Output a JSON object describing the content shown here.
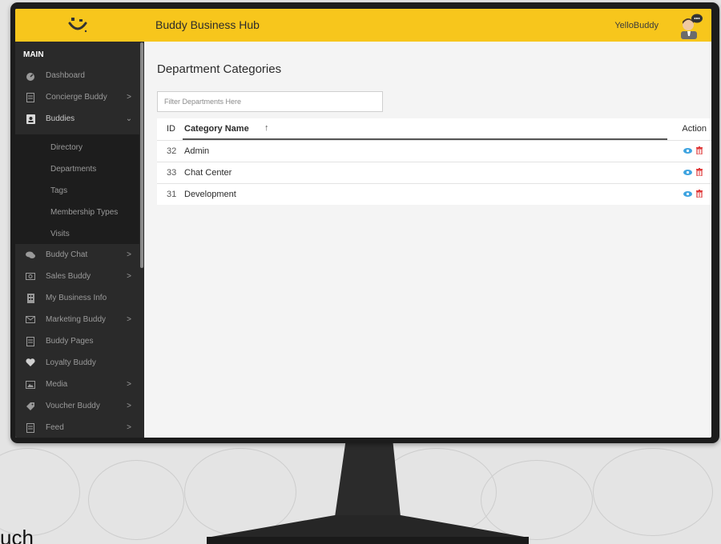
{
  "colors": {
    "accent": "#f7c61c",
    "sidebar_bg": "#2a2a2a",
    "view_icon": "#3da3e0",
    "delete_icon": "#e03a3a"
  },
  "header": {
    "app_title": "Buddy Business Hub",
    "user_name": "YelloBuddy"
  },
  "sidebar": {
    "section_label": "MAIN",
    "items": [
      {
        "label": "Dashboard",
        "icon": "dashboard-icon",
        "chevron": ""
      },
      {
        "label": "Concierge Buddy",
        "icon": "document-icon",
        "chevron": ">"
      },
      {
        "label": "Buddies",
        "icon": "contact-book-icon",
        "chevron": "⌄"
      },
      {
        "label": "Buddy Chat",
        "icon": "chat-icon",
        "chevron": ">"
      },
      {
        "label": "Sales Buddy",
        "icon": "money-icon",
        "chevron": ">"
      },
      {
        "label": "My Business Info",
        "icon": "building-icon",
        "chevron": ""
      },
      {
        "label": "Marketing Buddy",
        "icon": "envelope-icon",
        "chevron": ">"
      },
      {
        "label": "Buddy Pages",
        "icon": "document-icon",
        "chevron": ""
      },
      {
        "label": "Loyalty Buddy",
        "icon": "heart-icon",
        "chevron": ""
      },
      {
        "label": "Media",
        "icon": "image-icon",
        "chevron": ">"
      },
      {
        "label": "Voucher Buddy",
        "icon": "tag-icon",
        "chevron": ">"
      },
      {
        "label": "Feed",
        "icon": "document-icon",
        "chevron": ">"
      }
    ],
    "subitems": [
      {
        "label": "Directory"
      },
      {
        "label": "Departments"
      },
      {
        "label": "Tags"
      },
      {
        "label": "Membership Types"
      },
      {
        "label": "Visits"
      }
    ]
  },
  "main": {
    "page_title": "Department Categories",
    "filter_placeholder": "Filter Departments Here",
    "table": {
      "columns": {
        "id": "ID",
        "name": "Category Name",
        "sort_indicator": "↑",
        "action": "Action"
      },
      "rows": [
        {
          "id": "32",
          "name": "Admin"
        },
        {
          "id": "33",
          "name": "Chat Center"
        },
        {
          "id": "31",
          "name": "Development"
        }
      ]
    }
  },
  "background": {
    "caption": "uch"
  }
}
